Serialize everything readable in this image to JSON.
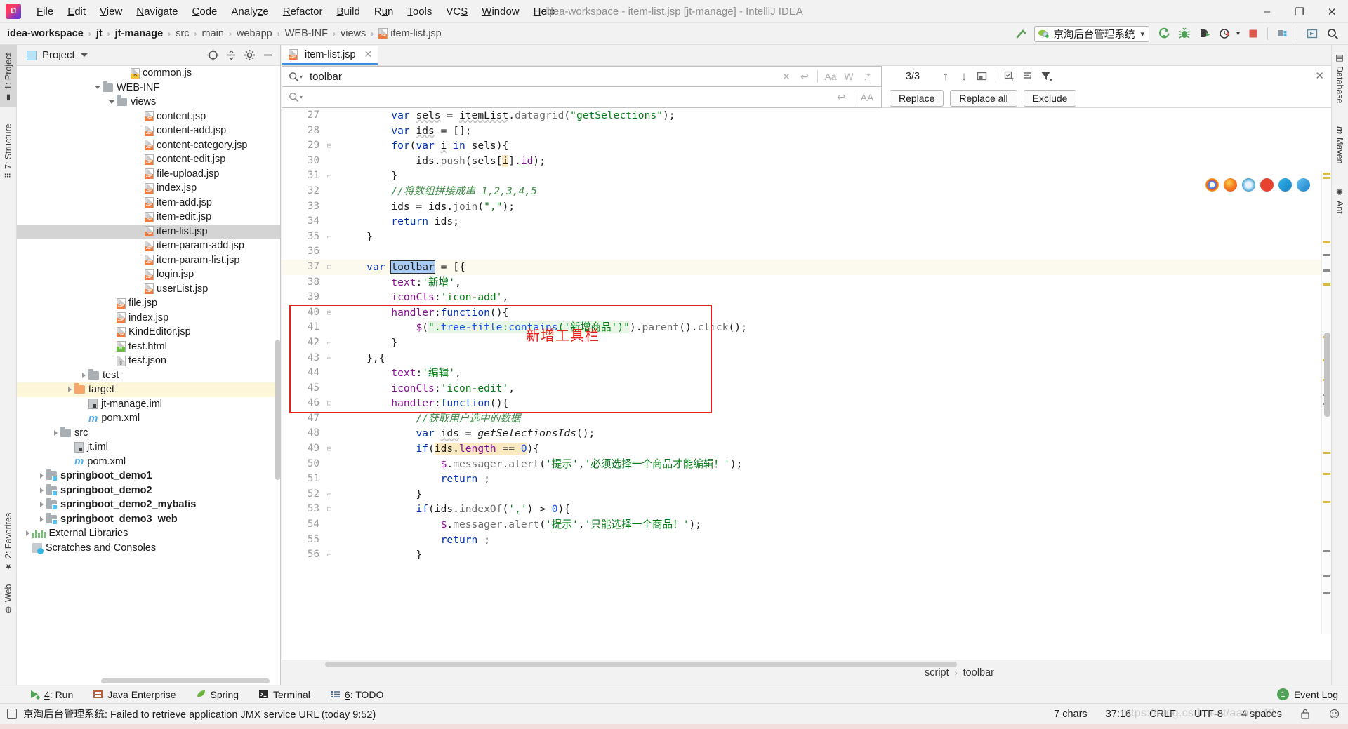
{
  "window": {
    "title": "idea-workspace - item-list.jsp [jt-manage] - IntelliJ IDEA",
    "minimize": "–",
    "maximize": "❐",
    "close": "✕",
    "logo_icon": "intellij-idea-logo"
  },
  "menu": [
    {
      "label": "File",
      "mnemonic": "F"
    },
    {
      "label": "Edit",
      "mnemonic": "E"
    },
    {
      "label": "View",
      "mnemonic": "V"
    },
    {
      "label": "Navigate",
      "mnemonic": "N"
    },
    {
      "label": "Code",
      "mnemonic": "C"
    },
    {
      "label": "Analyze",
      "mnemonic": "z"
    },
    {
      "label": "Refactor",
      "mnemonic": "R"
    },
    {
      "label": "Build",
      "mnemonic": "B"
    },
    {
      "label": "Run",
      "mnemonic": "u"
    },
    {
      "label": "Tools",
      "mnemonic": "T"
    },
    {
      "label": "VCS",
      "mnemonic": "S"
    },
    {
      "label": "Window",
      "mnemonic": "W"
    },
    {
      "label": "Help",
      "mnemonic": "H"
    }
  ],
  "breadcrumb": {
    "items": [
      {
        "label": "idea-workspace",
        "bold": true
      },
      {
        "label": "jt",
        "bold": true
      },
      {
        "label": "jt-manage",
        "bold": true
      },
      {
        "label": "src",
        "bold": false
      },
      {
        "label": "main",
        "bold": false
      },
      {
        "label": "webapp",
        "bold": false
      },
      {
        "label": "WEB-INF",
        "bold": false
      },
      {
        "label": "views",
        "bold": false
      },
      {
        "label": "item-list.jsp",
        "bold": false,
        "icon": "jsp-file-icon"
      }
    ],
    "separator": "›"
  },
  "toolbar": {
    "hammer_icon": "build-hammer-icon",
    "run_config": {
      "label": "京淘后台管理系统",
      "icon": "tomcat-icon",
      "dropdown": "▾"
    },
    "actions": [
      {
        "name": "run-button",
        "icon": "run-icon",
        "color": "#4ea357"
      },
      {
        "name": "debug-button",
        "icon": "debug-bug-icon",
        "color": "#4ea357"
      },
      {
        "name": "run-with-coverage-button",
        "icon": "coverage-icon",
        "color": "#3c3c3c"
      },
      {
        "name": "profile-button",
        "icon": "profiler-icon",
        "color": "#3c3c3c"
      },
      {
        "name": "stop-button",
        "icon": "stop-square-icon",
        "color": "#e05a4f"
      },
      {
        "name": "project-structure-button",
        "icon": "project-structure-icon",
        "color": "#3c3c3c"
      },
      {
        "name": "update-project-button",
        "icon": "update-icon",
        "color": "#3c3c3c"
      },
      {
        "name": "search-everywhere-button",
        "icon": "search-icon",
        "color": "#3c3c3c"
      }
    ]
  },
  "left_tool_strip": [
    {
      "label": "1: Project",
      "mnemonic": "1",
      "icon": "project-folder-icon",
      "selected": true
    },
    {
      "label": "7: Structure",
      "mnemonic": "7",
      "icon": "structure-icon",
      "selected": false
    },
    {
      "label": "2: Favorites",
      "mnemonic": "2",
      "icon": "star-icon",
      "selected": false
    },
    {
      "label": "Web",
      "mnemonic": "",
      "icon": "web-globe-icon",
      "selected": false
    }
  ],
  "right_tool_strip": [
    {
      "label": "Database",
      "icon": "database-icon"
    },
    {
      "label": "Maven",
      "icon": "maven-m-icon"
    },
    {
      "label": "Ant",
      "icon": "ant-bug-icon"
    }
  ],
  "project_panel": {
    "title": "Project",
    "dropdown_icon": "chevron-down-icon",
    "header_actions": [
      {
        "name": "locate-button",
        "icon": "crosshair-icon"
      },
      {
        "name": "collapse-all-button",
        "icon": "collapse-all-icon"
      },
      {
        "name": "settings-button",
        "icon": "gear-icon"
      },
      {
        "name": "hide-button",
        "icon": "minus-icon"
      }
    ],
    "tree": [
      {
        "label": "common.js",
        "indent": 7,
        "icon": "js-file-icon",
        "arrow": "",
        "state": ""
      },
      {
        "label": "WEB-INF",
        "indent": 5,
        "icon": "folder-icon",
        "arrow": "down",
        "state": ""
      },
      {
        "label": "views",
        "indent": 6,
        "icon": "folder-icon",
        "arrow": "down",
        "state": ""
      },
      {
        "label": "content.jsp",
        "indent": 8,
        "icon": "jsp-file-icon",
        "arrow": "",
        "state": ""
      },
      {
        "label": "content-add.jsp",
        "indent": 8,
        "icon": "jsp-file-icon",
        "arrow": "",
        "state": ""
      },
      {
        "label": "content-category.jsp",
        "indent": 8,
        "icon": "jsp-file-icon",
        "arrow": "",
        "state": ""
      },
      {
        "label": "content-edit.jsp",
        "indent": 8,
        "icon": "jsp-file-icon",
        "arrow": "",
        "state": ""
      },
      {
        "label": "file-upload.jsp",
        "indent": 8,
        "icon": "jsp-file-icon",
        "arrow": "",
        "state": ""
      },
      {
        "label": "index.jsp",
        "indent": 8,
        "icon": "jsp-file-icon",
        "arrow": "",
        "state": ""
      },
      {
        "label": "item-add.jsp",
        "indent": 8,
        "icon": "jsp-file-icon",
        "arrow": "",
        "state": ""
      },
      {
        "label": "item-edit.jsp",
        "indent": 8,
        "icon": "jsp-file-icon",
        "arrow": "",
        "state": ""
      },
      {
        "label": "item-list.jsp",
        "indent": 8,
        "icon": "jsp-file-icon",
        "arrow": "",
        "state": "selected"
      },
      {
        "label": "item-param-add.jsp",
        "indent": 8,
        "icon": "jsp-file-icon",
        "arrow": "",
        "state": ""
      },
      {
        "label": "item-param-list.jsp",
        "indent": 8,
        "icon": "jsp-file-icon",
        "arrow": "",
        "state": ""
      },
      {
        "label": "login.jsp",
        "indent": 8,
        "icon": "jsp-file-icon",
        "arrow": "",
        "state": ""
      },
      {
        "label": "userList.jsp",
        "indent": 8,
        "icon": "jsp-file-icon",
        "arrow": "",
        "state": ""
      },
      {
        "label": "file.jsp",
        "indent": 6,
        "icon": "jsp-file-icon",
        "arrow": "",
        "state": ""
      },
      {
        "label": "index.jsp",
        "indent": 6,
        "icon": "jsp-file-icon",
        "arrow": "",
        "state": ""
      },
      {
        "label": "KindEditor.jsp",
        "indent": 6,
        "icon": "jsp-file-icon",
        "arrow": "",
        "state": ""
      },
      {
        "label": "test.html",
        "indent": 6,
        "icon": "html-file-icon",
        "arrow": "",
        "state": ""
      },
      {
        "label": "test.json",
        "indent": 6,
        "icon": "json-file-icon",
        "arrow": "",
        "state": ""
      },
      {
        "label": "test",
        "indent": 4,
        "icon": "folder-icon",
        "arrow": "right",
        "state": ""
      },
      {
        "label": "target",
        "indent": 3,
        "icon": "folder-orange-icon",
        "arrow": "right",
        "state": "highlight"
      },
      {
        "label": "jt-manage.iml",
        "indent": 4,
        "icon": "iml-file-icon",
        "arrow": "",
        "state": ""
      },
      {
        "label": "pom.xml",
        "indent": 4,
        "icon": "maven-m-icon",
        "arrow": "",
        "state": ""
      },
      {
        "label": "src",
        "indent": 2,
        "icon": "folder-icon",
        "arrow": "right",
        "state": ""
      },
      {
        "label": "jt.iml",
        "indent": 3,
        "icon": "iml-file-icon",
        "arrow": "",
        "state": ""
      },
      {
        "label": "pom.xml",
        "indent": 3,
        "icon": "maven-m-icon",
        "arrow": "",
        "state": ""
      },
      {
        "label": "springboot_demo1",
        "indent": 1,
        "icon": "module-folder-icon",
        "arrow": "right",
        "state": "",
        "bold": true
      },
      {
        "label": "springboot_demo2",
        "indent": 1,
        "icon": "module-folder-icon",
        "arrow": "right",
        "state": "",
        "bold": true
      },
      {
        "label": "springboot_demo2_mybatis",
        "indent": 1,
        "icon": "module-folder-icon",
        "arrow": "right",
        "state": "",
        "bold": true
      },
      {
        "label": "springboot_demo3_web",
        "indent": 1,
        "icon": "module-folder-icon",
        "arrow": "right",
        "state": "",
        "bold": true
      },
      {
        "label": "External Libraries",
        "indent": 0,
        "icon": "libraries-icon",
        "arrow": "right",
        "state": ""
      },
      {
        "label": "Scratches and Consoles",
        "indent": 0,
        "icon": "scratches-icon",
        "arrow": "",
        "state": ""
      }
    ]
  },
  "editor": {
    "tab": {
      "label": "item-list.jsp",
      "icon": "jsp-file-icon",
      "close": "✕"
    },
    "annotation_arrow": "red-left-arrow-annotation",
    "find": {
      "search_value": "toolbar",
      "search_placeholder": "",
      "replace_value": "",
      "replace_placeholder": "",
      "clear_icon": "✕",
      "history_icon": "↩",
      "match_case": "Aa",
      "words": "W",
      "regex": ".*",
      "preserve_case": "ÁA",
      "match_count": "3/3",
      "prev_icon": "↑",
      "next_icon": "↓",
      "select_all_icon": "select-all-occurrences-icon",
      "in_selection_icon": "in-selection-icon",
      "filter_icon": "filter-icon",
      "close_icon": "✕",
      "buttons": [
        "Replace",
        "Replace all",
        "Exclude"
      ]
    },
    "annotation": {
      "label": "新增工具栏",
      "color": "#e8211a"
    },
    "browser_icons": [
      "chrome-icon",
      "firefox-icon",
      "safari-icon",
      "opera-icon",
      "edge-icon",
      "ie-icon"
    ],
    "breadcrumb_bottom": [
      "script",
      "toolbar"
    ],
    "code_lines": [
      {
        "n": 27,
        "fold": "",
        "cur": false,
        "html": "        <span class='kw'>var</span> <span class='squig'>sels</span> = <span class='squig'>itemList</span>.<span class='gry'>datagrid</span>(<span class='str'>\"getSelections\"</span>);"
      },
      {
        "n": 28,
        "fold": "",
        "cur": false,
        "html": "        <span class='kw'>var</span> <span class='squig'>ids</span> = [];"
      },
      {
        "n": 29,
        "fold": "-",
        "cur": false,
        "html": "        <span class='kw'>for</span>(<span class='kw'>var</span> <span class='squig'>i</span> <span class='kw'>in</span> sels){"
      },
      {
        "n": 30,
        "fold": "",
        "cur": false,
        "html": "            ids.<span class='gry'>push</span>(sels[<span class='hi-occ'>i</span>].<span class='prop'>id</span>);"
      },
      {
        "n": 31,
        "fold": "]",
        "cur": false,
        "html": "        }"
      },
      {
        "n": 32,
        "fold": "",
        "cur": false,
        "html": "        <span class='cmt'>//将数组拼接成串 1,2,3,4,5</span>"
      },
      {
        "n": 33,
        "fold": "",
        "cur": false,
        "html": "        ids = ids.<span class='gry'>join</span>(<span class='str'>\",\"</span>);"
      },
      {
        "n": 34,
        "fold": "",
        "cur": false,
        "html": "        <span class='kw'>return</span> ids;"
      },
      {
        "n": 35,
        "fold": "]",
        "cur": false,
        "html": "    }"
      },
      {
        "n": 36,
        "fold": "",
        "cur": false,
        "html": ""
      },
      {
        "n": 37,
        "fold": "-",
        "cur": true,
        "html": "    <span class='kw'>var</span> <span class='hi-sel'>toolbar</span> = [{"
      },
      {
        "n": 38,
        "fold": "",
        "cur": false,
        "html": "        <span class='prop'>text</span>:<span class='str'>'新增'</span>,"
      },
      {
        "n": 39,
        "fold": "",
        "cur": false,
        "html": "        <span class='prop'>iconCls</span>:<span class='str'>'icon-add'</span>,"
      },
      {
        "n": 40,
        "fold": "-",
        "cur": false,
        "html": "        <span class='prop'>handler</span>:<span class='kw'>function</span>(){"
      },
      {
        "n": 41,
        "fold": "",
        "cur": false,
        "html": "            <span class='prop'>$</span>(<span class='hi-str'><span class='str'>\".</span><span class='num'>tree-title</span><span class='str'>:</span><span class='num'>contains</span><span class='str'>(</span><span class='str'>'新增商品'</span><span class='str'>)\"</span></span>).<span class='gry'>parent</span>().<span class='gry'>click</span>();"
      },
      {
        "n": 42,
        "fold": "]",
        "cur": false,
        "html": "        }"
      },
      {
        "n": 43,
        "fold": "]",
        "cur": false,
        "html": "    },{"
      },
      {
        "n": 44,
        "fold": "",
        "cur": false,
        "html": "        <span class='prop'>text</span>:<span class='str'>'编辑'</span>,"
      },
      {
        "n": 45,
        "fold": "",
        "cur": false,
        "html": "        <span class='prop'>iconCls</span>:<span class='str'>'icon-edit'</span>,"
      },
      {
        "n": 46,
        "fold": "-",
        "cur": false,
        "html": "        <span class='prop'>handler</span>:<span class='kw'>function</span>(){"
      },
      {
        "n": 47,
        "fold": "",
        "cur": false,
        "html": "            <span class='cmt'>//获取用户选中的数据</span>"
      },
      {
        "n": 48,
        "fold": "",
        "cur": false,
        "html": "            <span class='kw'>var</span> <span class='squig'>ids</span> = <span class='fn'>getSelectionsIds</span>();"
      },
      {
        "n": 49,
        "fold": "-",
        "cur": false,
        "html": "            <span class='kw'>if</span>(<span class='hi-occ'>ids.<span class='prop'>length</span> == <span class='num'>0</span></span>){"
      },
      {
        "n": 50,
        "fold": "",
        "cur": false,
        "html": "                <span class='prop'>$</span>.<span class='gry'>messager</span>.<span class='gry'>alert</span>(<span class='str'>'提示'</span>,<span class='str'>'必须选择一个商品才能编辑！'</span>);"
      },
      {
        "n": 51,
        "fold": "",
        "cur": false,
        "html": "                <span class='kw'>return</span> ;"
      },
      {
        "n": 52,
        "fold": "]",
        "cur": false,
        "html": "            }"
      },
      {
        "n": 53,
        "fold": "-",
        "cur": false,
        "html": "            <span class='kw'>if</span>(ids.<span class='gry'>indexOf</span>(<span class='str'>','</span>) &gt; <span class='num'>0</span>){"
      },
      {
        "n": 54,
        "fold": "",
        "cur": false,
        "html": "                <span class='prop'>$</span>.<span class='gry'>messager</span>.<span class='gry'>alert</span>(<span class='str'>'提示'</span>,<span class='str'>'只能选择一个商品！'</span>);"
      },
      {
        "n": 55,
        "fold": "",
        "cur": false,
        "html": "                <span class='kw'>return</span> ;"
      },
      {
        "n": 56,
        "fold": "]",
        "cur": false,
        "html": "            }"
      }
    ]
  },
  "tool_window_bar": [
    {
      "label": "4: Run",
      "mnemonic": "4",
      "icon": "run-green-icon"
    },
    {
      "label": "Java Enterprise",
      "mnemonic": "",
      "icon": "java-enterprise-icon"
    },
    {
      "label": "Spring",
      "mnemonic": "",
      "icon": "spring-leaf-icon"
    },
    {
      "label": "Terminal",
      "mnemonic": "",
      "icon": "terminal-icon"
    },
    {
      "label": "6: TODO",
      "mnemonic": "6",
      "icon": "todo-list-icon"
    }
  ],
  "event_log": {
    "label": "Event Log",
    "count": "1"
  },
  "status_bar": {
    "message": "京淘后台管理系统: Failed to retrieve application JMX service URL (today 9:52)",
    "message_icon": "balloon-notification-icon",
    "chars": "7 chars",
    "caret": "37:16",
    "line_sep": "CRLF",
    "encoding": "UTF-8",
    "indent": "4 spaces",
    "lock_icon": "read-only-lock-icon",
    "analyze_icon": "inspection-face-icon"
  },
  "watermark": "https://blog.csdn.net/aaa5549..."
}
